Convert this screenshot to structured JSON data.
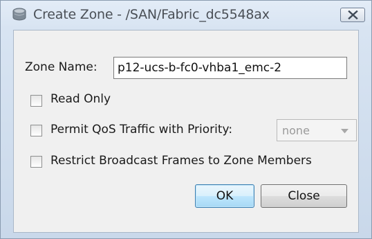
{
  "window": {
    "title": "Create Zone - /SAN/Fabric_dc5548ax"
  },
  "form": {
    "zone_name_label": "Zone Name:",
    "zone_name_value": "p12-ucs-b-fc0-vhba1_emc-2",
    "read_only_label": "Read Only",
    "read_only_checked": false,
    "permit_qos_label": "Permit QoS Traffic with Priority:",
    "permit_qos_checked": false,
    "priority_selected": "none",
    "priority_enabled": false,
    "restrict_broadcast_label": "Restrict Broadcast Frames to Zone Members",
    "restrict_broadcast_checked": false
  },
  "buttons": {
    "ok_label": "OK",
    "close_label": "Close"
  },
  "icons": {
    "app": "zone-cylinder-icon",
    "close": "close-x-icon",
    "dropdown": "chevron-down-icon"
  },
  "colors": {
    "title_text": "#4a4f56",
    "default_button_border": "#3c7fb1",
    "window_frame": "#c9d8ea"
  }
}
